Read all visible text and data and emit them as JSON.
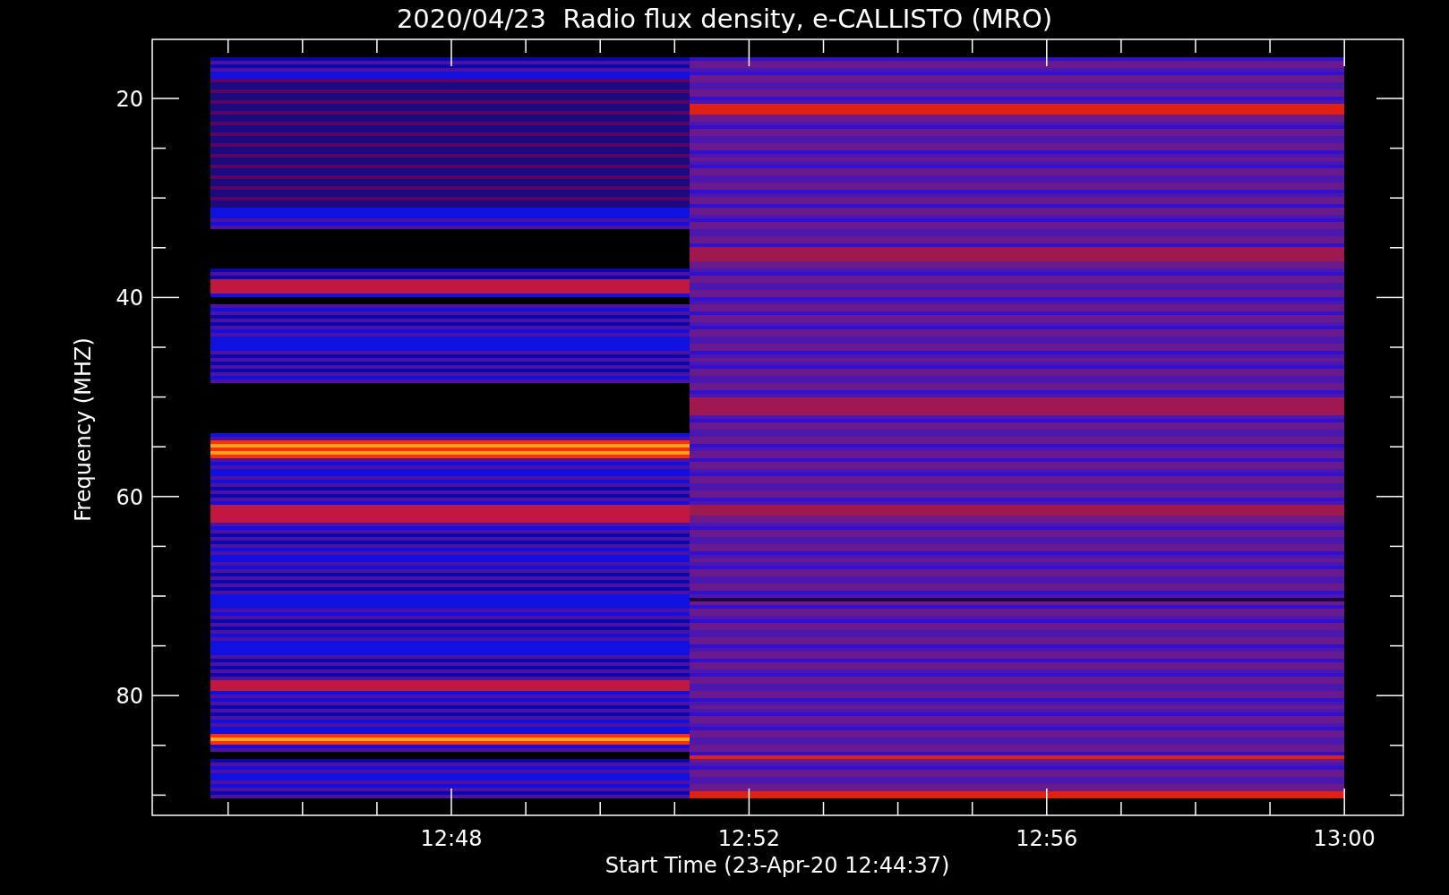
{
  "plot": {
    "title": "2020/04/23  Radio flux density, e-CALLISTO (MRO)",
    "ylabel": "Frequency (MHZ)",
    "xlabel": "Start Time (23-Apr-20 12:44:37)",
    "yticks": [
      "20",
      "40",
      "60",
      "80"
    ],
    "xticks": [
      "12:48",
      "12:52",
      "12:56",
      "13:00"
    ]
  }
}
